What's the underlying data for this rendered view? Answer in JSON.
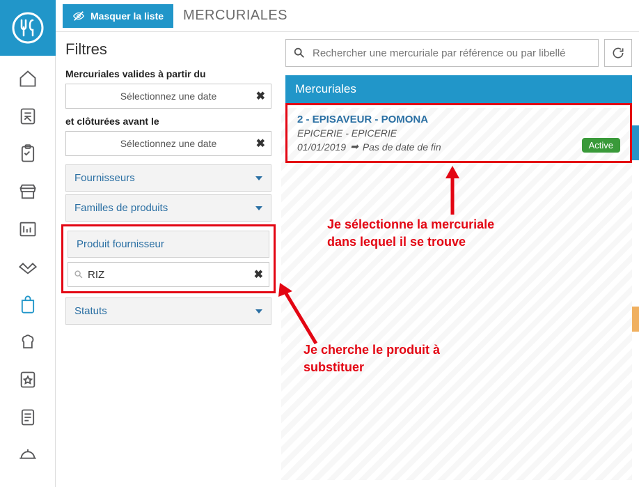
{
  "topbar": {
    "hide_label": "Masquer la liste",
    "page_title": "MERCURIALES"
  },
  "filters": {
    "title": "Filtres",
    "valid_from_label": "Mercuriales valides à partir du",
    "closed_before_label": "et clôturées avant le",
    "date_placeholder": "Sélectionnez une date",
    "sections": {
      "suppliers": "Fournisseurs",
      "families": "Familles de produits",
      "supplier_product": "Produit fournisseur",
      "statuses": "Statuts"
    },
    "product_search_value": "RIZ"
  },
  "search": {
    "placeholder": "Rechercher une mercuriale par référence ou par libellé"
  },
  "panel": {
    "head": "Mercuriales",
    "card": {
      "title": "2 - EPISAVEUR - POMONA",
      "subtitle": "EPICERIE - EPICERIE",
      "date_start": "01/01/2019",
      "date_end": "Pas de date de fin",
      "badge": "Active"
    }
  },
  "annotations": {
    "a1_l1": "Je sélectionne la mercuriale",
    "a1_l2": "dans lequel il se trouve",
    "a2_l1": "Je cherche le produit à",
    "a2_l2": "substituer"
  }
}
